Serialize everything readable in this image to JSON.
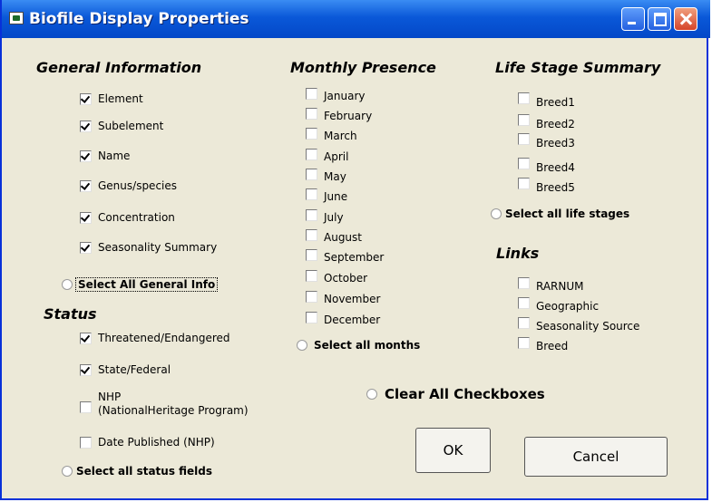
{
  "window": {
    "title": "Biofile Display Properties"
  },
  "general_info": {
    "heading": "General Information",
    "items": [
      {
        "label": "Element",
        "checked": true
      },
      {
        "label": "Subelement",
        "checked": true
      },
      {
        "label": "Name",
        "checked": true
      },
      {
        "label": "Genus/species",
        "checked": true
      },
      {
        "label": "Concentration",
        "checked": true
      },
      {
        "label": "Seasonality Summary",
        "checked": true
      }
    ],
    "select_all": "Select All General Info"
  },
  "status": {
    "heading": "Status",
    "items": [
      {
        "label": "Threatened/Endangered",
        "checked": true
      },
      {
        "label": "State/Federal",
        "checked": true
      },
      {
        "label": "NHP",
        "label2": "(NationalHeritage Program)",
        "checked": false
      },
      {
        "label": "Date Published (NHP)",
        "checked": false
      }
    ],
    "select_all": "Select all status fields"
  },
  "monthly": {
    "heading": "Monthly Presence",
    "items": [
      {
        "label": "January",
        "checked": false
      },
      {
        "label": "February",
        "checked": false
      },
      {
        "label": "March",
        "checked": false
      },
      {
        "label": "April",
        "checked": false
      },
      {
        "label": "May",
        "checked": false
      },
      {
        "label": "June",
        "checked": false
      },
      {
        "label": "July",
        "checked": false
      },
      {
        "label": "August",
        "checked": false
      },
      {
        "label": "September",
        "checked": false
      },
      {
        "label": "October",
        "checked": false
      },
      {
        "label": "November",
        "checked": false
      },
      {
        "label": "December",
        "checked": false
      }
    ],
    "select_all": "Select all months"
  },
  "life_stage": {
    "heading": "Life Stage Summary",
    "items": [
      {
        "label": "Breed1",
        "checked": false
      },
      {
        "label": "Breed2",
        "checked": false
      },
      {
        "label": "Breed3",
        "checked": false
      },
      {
        "label": "Breed4",
        "checked": false
      },
      {
        "label": "Breed5",
        "checked": false
      }
    ],
    "select_all": "Select all life stages"
  },
  "links": {
    "heading": "Links",
    "items": [
      {
        "label": "RARNUM",
        "checked": false
      },
      {
        "label": "Geographic",
        "checked": false
      },
      {
        "label": "Seasonality Source",
        "checked": false
      },
      {
        "label": "Breed",
        "checked": false
      }
    ]
  },
  "clear_all": "Clear All Checkboxes",
  "buttons": {
    "ok": "OK",
    "cancel": "Cancel"
  }
}
